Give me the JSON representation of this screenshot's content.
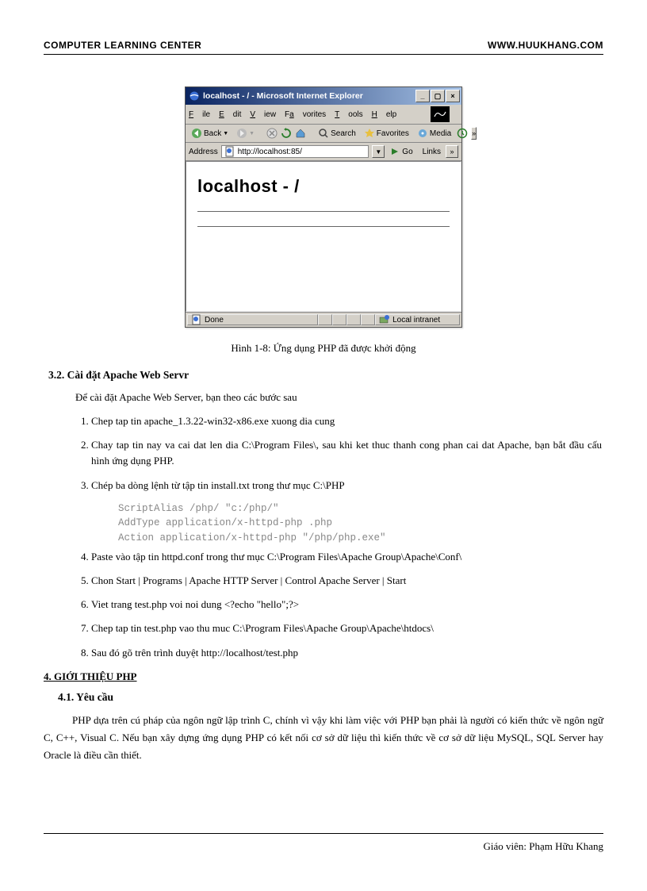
{
  "header": {
    "left": "COMPUTER LEARNING CENTER",
    "right": "WWW.HUUKHANG.COM"
  },
  "ie": {
    "title": "localhost - / - Microsoft Internet Explorer",
    "menu": {
      "file": "File",
      "edit": "Edit",
      "view": "View",
      "favorites": "Favorites",
      "tools": "Tools",
      "help": "Help"
    },
    "toolbar": {
      "back": "Back",
      "search": "Search",
      "favorites": "Favorites",
      "media": "Media"
    },
    "address_label": "Address",
    "address_value": "http://localhost:85/",
    "go": "Go",
    "links": "Links",
    "page_title": "localhost - /",
    "status_done": "Done",
    "status_zone": "Local intranet"
  },
  "caption": "Hình 1-8: Ứng dụng PHP đã được khởi động",
  "section32": {
    "title": "3.2. Cài đặt Apache Web Servr",
    "intro": "Để cài đặt Apache Web Server, bạn theo các bước sau",
    "steps": [
      "Chep tap tin apache_1.3.22-win32-x86.exe xuong dia cung",
      "Chay tap tin nay va cai dat len dia C:\\Program Files\\, sau khi ket thuc thanh cong phan cai dat Apache, bạn bắt đầu cấu hình ứng dụng PHP.",
      "Chép ba dòng lệnh từ tập tin install.txt trong thư mục C:\\PHP"
    ],
    "code": "ScriptAlias /php/ \"c:/php/\"\nAddType application/x-httpd-php .php\nAction application/x-httpd-php \"/php/php.exe\"",
    "steps2": [
      "Paste vào tập tin httpd.conf trong thư mục  C:\\Program Files\\Apache Group\\Apache\\Conf\\",
      "Chon Start | Programs | Apache HTTP Server | Control Apache Server | Start",
      "Viet trang test.php voi noi dung   <?echo \"hello\";?>",
      "Chep tap tin test.php vao thu muc C:\\Program Files\\Apache Group\\Apache\\htdocs\\",
      "Sau đó gõ trên trình duyệt http://localhost/test.php"
    ]
  },
  "section4": {
    "title": "4. GIỚI THIỆU PHP"
  },
  "section41": {
    "title": "4.1. Yêu cầu",
    "body": "PHP dựa trên cú pháp của ngôn ngữ lập trình C, chính vì vậy khi làm việc với PHP bạn phải là người có kiến thức về ngôn ngữ  C, C++, Visual C. Nếu bạn xây dựng ứng dụng PHP có kết nối cơ sở dữ liệu thì kiến thức về cơ sở dữ liệu MySQL, SQL Server hay Oracle là điều cần thiết."
  },
  "footer": "Giáo viên: Phạm Hữu Khang"
}
